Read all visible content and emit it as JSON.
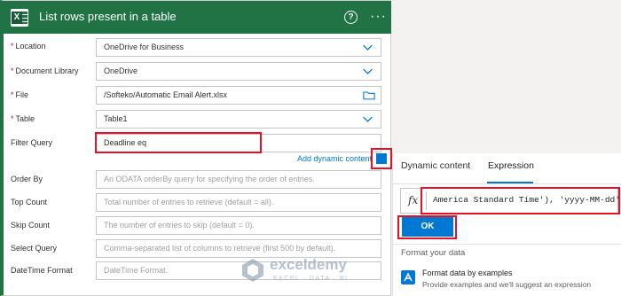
{
  "card": {
    "title": "List rows present in a table",
    "help_glyph": "?",
    "more_glyph": "···",
    "accent": "#217346"
  },
  "fields": {
    "location": {
      "label": "Location",
      "required": true,
      "value": "OneDrive for Business"
    },
    "document_library": {
      "label": "Document Library",
      "required": true,
      "value": "OneDrive"
    },
    "file": {
      "label": "File",
      "required": true,
      "value": "/Softeko/Automatic Email Alert.xlsx"
    },
    "table": {
      "label": "Table",
      "required": true,
      "value": "Table1"
    },
    "filter_query": {
      "label": "Filter Query",
      "value": "Deadline eq"
    },
    "add_dynamic_content": "Add dynamic content",
    "order_by": {
      "label": "Order By",
      "placeholder": "An ODATA orderBy query for specifying the order of entries."
    },
    "top_count": {
      "label": "Top Count",
      "placeholder": "Total number of entries to retrieve (default = all)."
    },
    "skip_count": {
      "label": "Skip Count",
      "placeholder": "The number of entries to skip (default = 0)."
    },
    "select_query": {
      "label": "Select Query",
      "placeholder": "Comma-separated list of columns to retrieve (first 500 by default)."
    },
    "datetime_format": {
      "label": "DateTime Format",
      "placeholder": "DateTime Format."
    }
  },
  "panel": {
    "tabs": [
      "Dynamic content",
      "Expression"
    ],
    "active_tab": "Expression",
    "fx_symbol": "fx",
    "expression": "America Standard Time'), 'yyyy-MM-dd')",
    "ok_label": "OK",
    "format_label": "Format your data",
    "format_item_title": "Format data by examples",
    "format_item_subtitle": "Provide examples and we'll suggest an expression"
  },
  "watermark": {
    "name": "exceldemy",
    "sub": "EXCEL · DATA · BI"
  },
  "colors": {
    "highlight": "#e81123",
    "link": "#0078d4"
  }
}
